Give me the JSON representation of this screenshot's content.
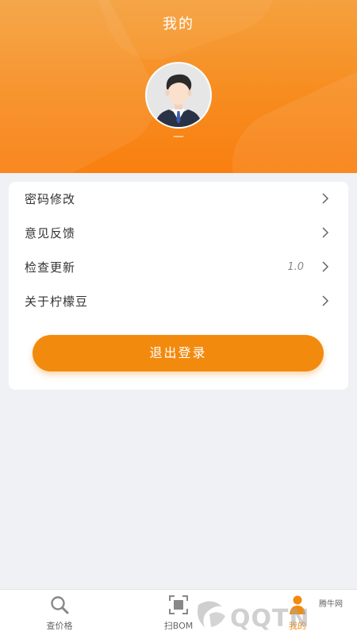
{
  "header": {
    "title": "我的",
    "username": "—"
  },
  "menu": {
    "items": [
      {
        "label": "密码修改",
        "value": ""
      },
      {
        "label": "意见反馈",
        "value": ""
      },
      {
        "label": "检查更新",
        "value": "1.0"
      },
      {
        "label": "关于柠檬豆",
        "value": ""
      }
    ],
    "logout_label": "退出登录"
  },
  "tabbar": {
    "tabs": [
      {
        "label": "查价格",
        "icon": "magnifier-icon"
      },
      {
        "label": "扫BOM",
        "icon": "scan-icon"
      },
      {
        "label": "我的",
        "icon": "person-icon"
      }
    ]
  },
  "watermark": {
    "brand": "QQTN",
    "tag": "腾牛网"
  },
  "colors": {
    "accent": "#f28a0e",
    "header_top": "#f5a13e",
    "header_bottom": "#f97f10",
    "background": "#f0f1f5"
  }
}
